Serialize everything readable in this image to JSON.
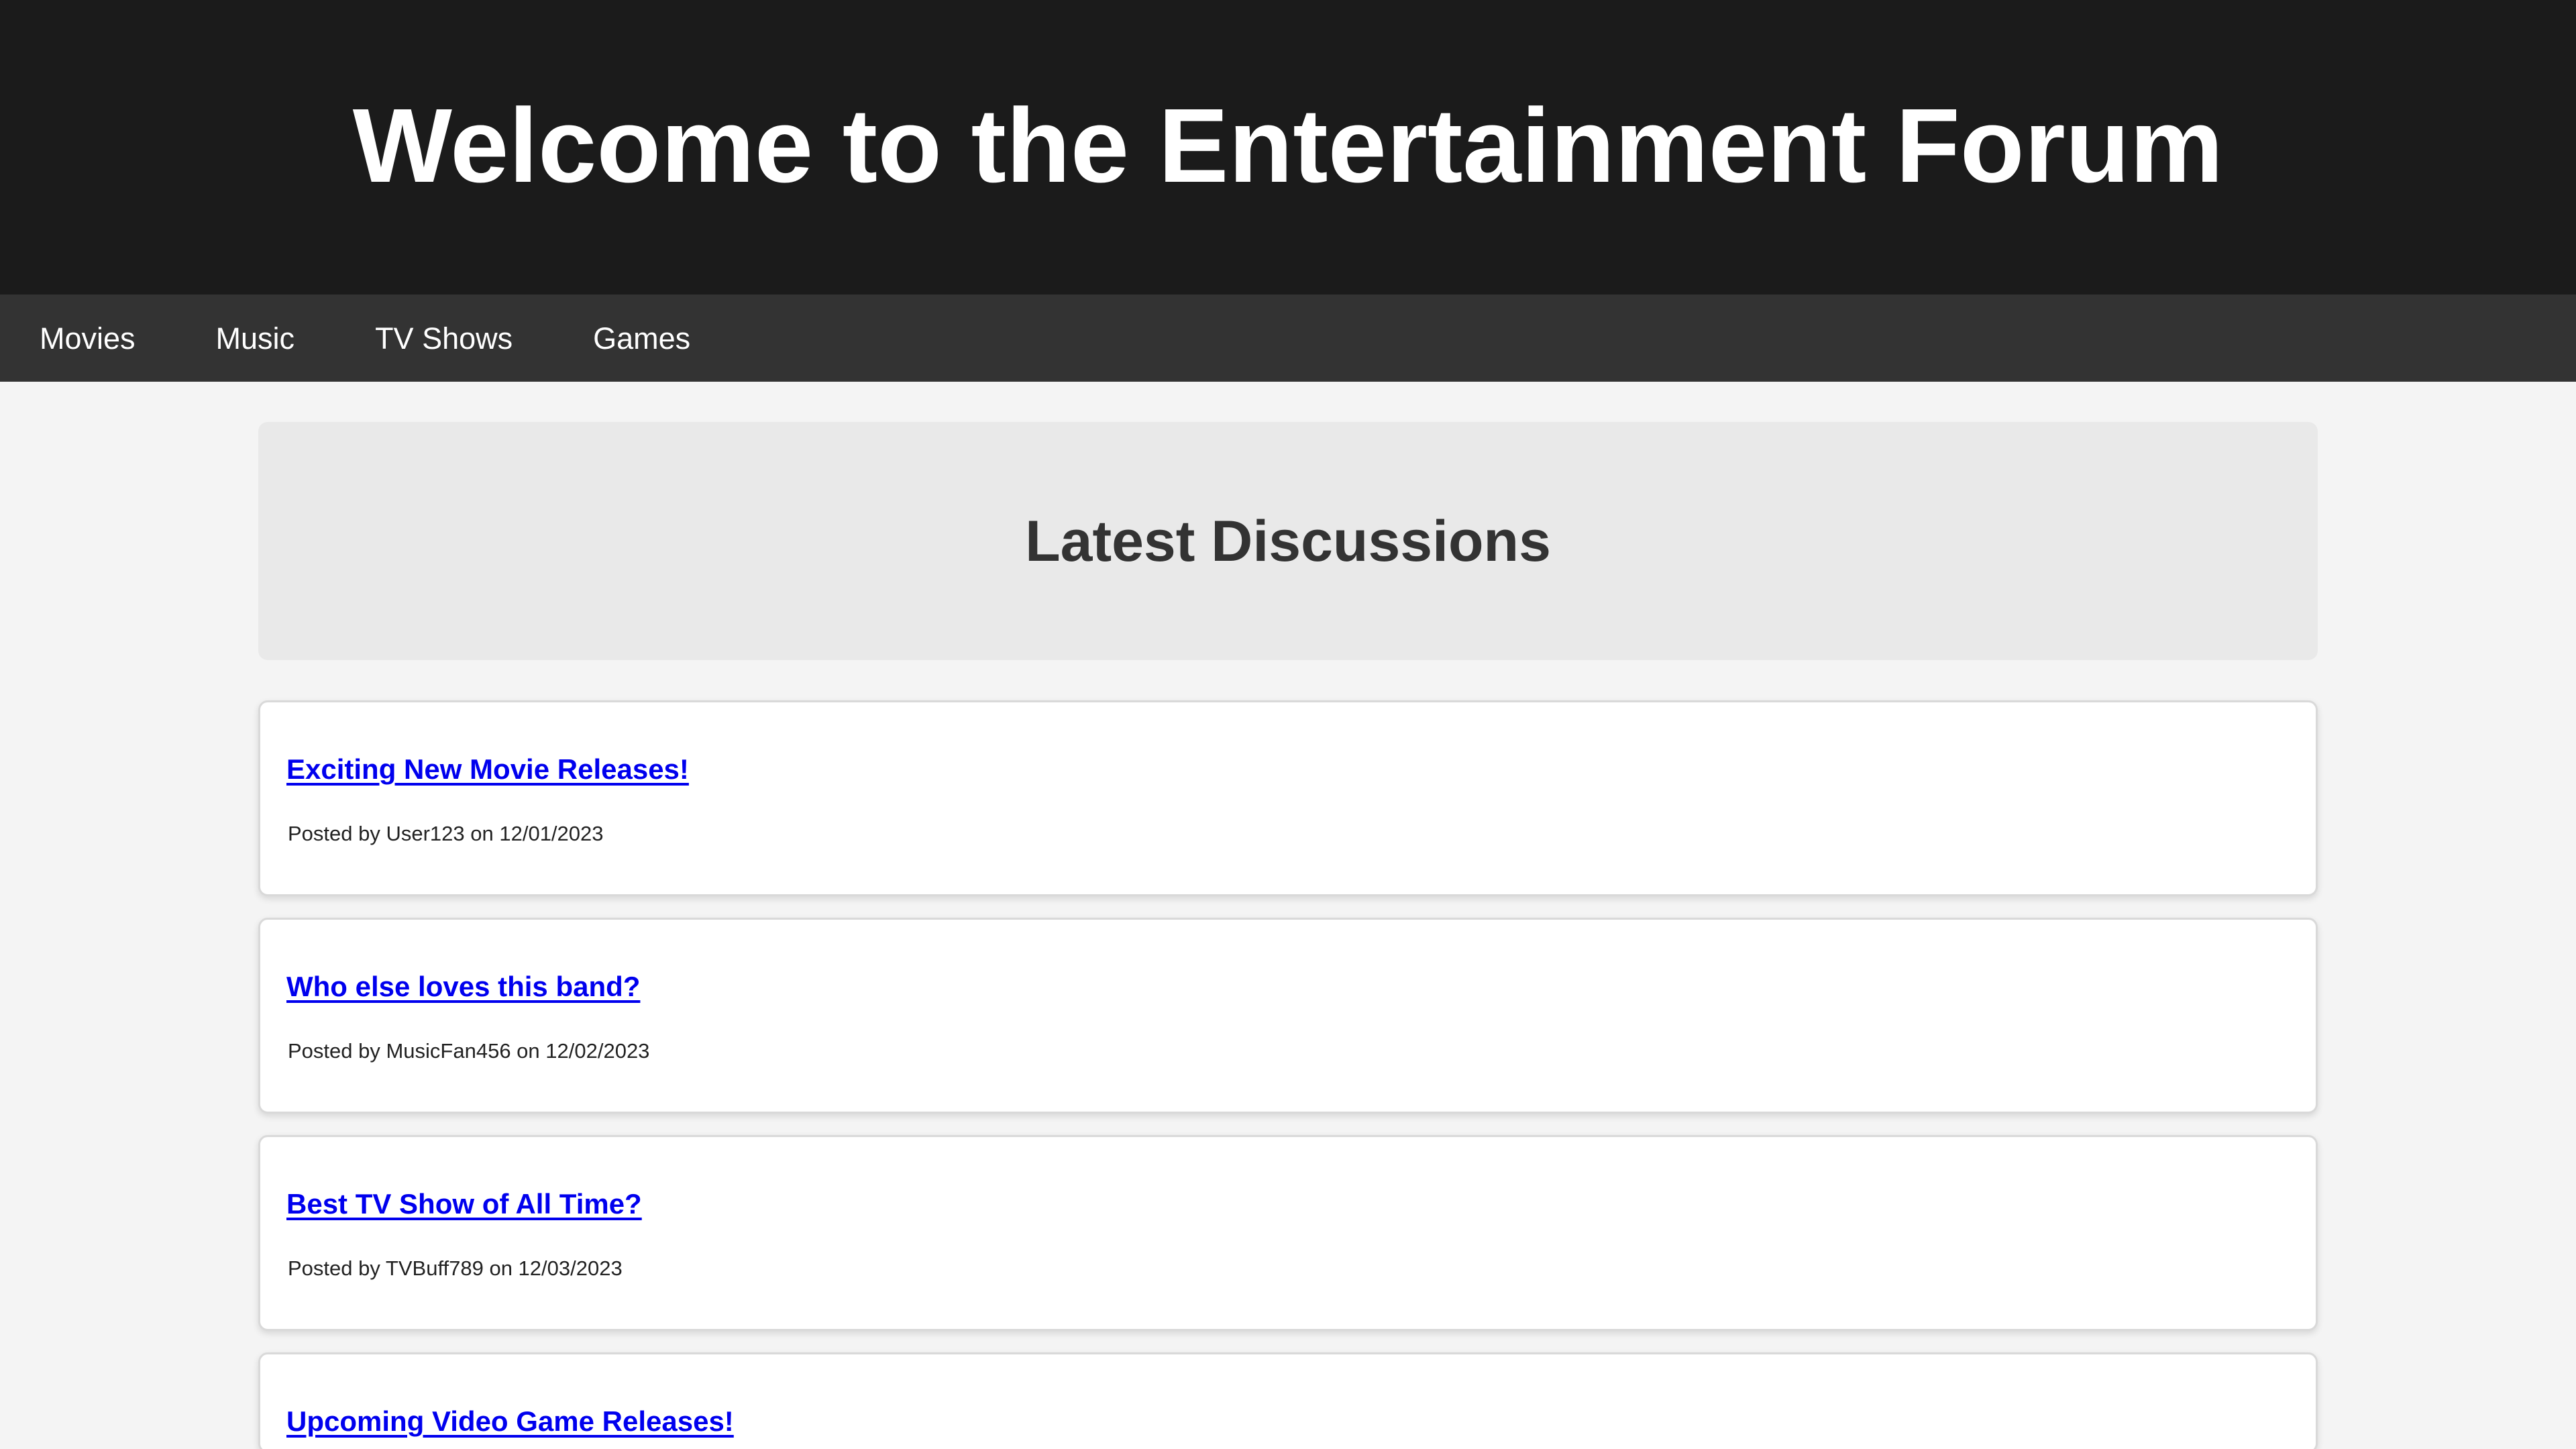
{
  "header": {
    "title": "Welcome to the Entertainment Forum"
  },
  "nav": {
    "items": [
      {
        "label": "Movies"
      },
      {
        "label": "Music"
      },
      {
        "label": "TV Shows"
      },
      {
        "label": "Games"
      }
    ]
  },
  "discussions": {
    "heading": "Latest Discussions",
    "posts": [
      {
        "title": "Exciting New Movie Releases!",
        "meta": "Posted by User123 on 12/01/2023"
      },
      {
        "title": "Who else loves this band?",
        "meta": "Posted by MusicFan456 on 12/02/2023"
      },
      {
        "title": "Best TV Show of All Time?",
        "meta": "Posted by TVBuff789 on 12/03/2023"
      },
      {
        "title": "Upcoming Video Game Releases!",
        "meta": ""
      }
    ]
  },
  "colors": {
    "header_bg": "#1b1b1b",
    "nav_bg": "#333333",
    "page_bg": "#f4f4f4",
    "link": "#0000ee"
  }
}
